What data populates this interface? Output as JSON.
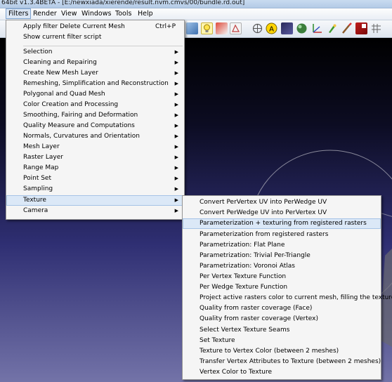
{
  "window": {
    "title": "64bit v1.3.4BETA - [E:/newxiada/xierende/result.nvm.cmvs/00/bundle.rd.out]"
  },
  "menubar": {
    "items": [
      "Filters",
      "Render",
      "View",
      "Windows",
      "Tools",
      "Help"
    ]
  },
  "filters_menu": {
    "top": [
      {
        "label": "Apply filter Delete Current Mesh",
        "shortcut": "Ctrl+P"
      },
      {
        "label": "Show current filter script",
        "shortcut": ""
      }
    ],
    "categories": [
      "Selection",
      "Cleaning and Repairing",
      "Create New Mesh Layer",
      "Remeshing, Simplification and Reconstruction",
      "Polygonal and Quad Mesh",
      "Color Creation and Processing",
      "Smoothing, Fairing and Deformation",
      "Quality Measure and Computations",
      "Normals, Curvatures and Orientation",
      "Mesh Layer",
      "Raster Layer",
      "Range Map",
      "Point Set",
      "Sampling",
      "Texture",
      "Camera"
    ],
    "highlighted": "Texture"
  },
  "texture_submenu": {
    "items": [
      "Convert PerVertex UV into PerWedge UV",
      "Convert PerWedge UV into PerVertex UV",
      "Parameterization + texturing from registered rasters",
      "Parameterization from registered rasters",
      "Parametrization: Flat Plane",
      "Parametrization: Trivial Per-Triangle",
      "Parametrization: Voronoi Atlas",
      "Per Vertex Texture Function",
      "Per Wedge Texture Function",
      "Project active rasters color to current mesh, filling the texture",
      "Quality from raster coverage (Face)",
      "Quality from raster coverage (Vertex)",
      "Select Vertex Texture Seams",
      "Set Texture",
      "Texture to Vertex Color (between 2 meshes)",
      "Transfer Vertex Attributes to Texture (between 2 meshes)",
      "Vertex Color to Texture"
    ],
    "highlighted": "Parameterization + texturing from registered rasters"
  },
  "toolbar": {
    "icons": [
      "texture-icon",
      "lightbulb-icon",
      "color-icon",
      "shader-icon",
      "align-icon",
      "annotation-a-icon",
      "raster-icon",
      "sphere-icon",
      "axis-icon",
      "paint-icon",
      "brush-icon",
      "pdf-icon",
      "grid-icon"
    ]
  }
}
